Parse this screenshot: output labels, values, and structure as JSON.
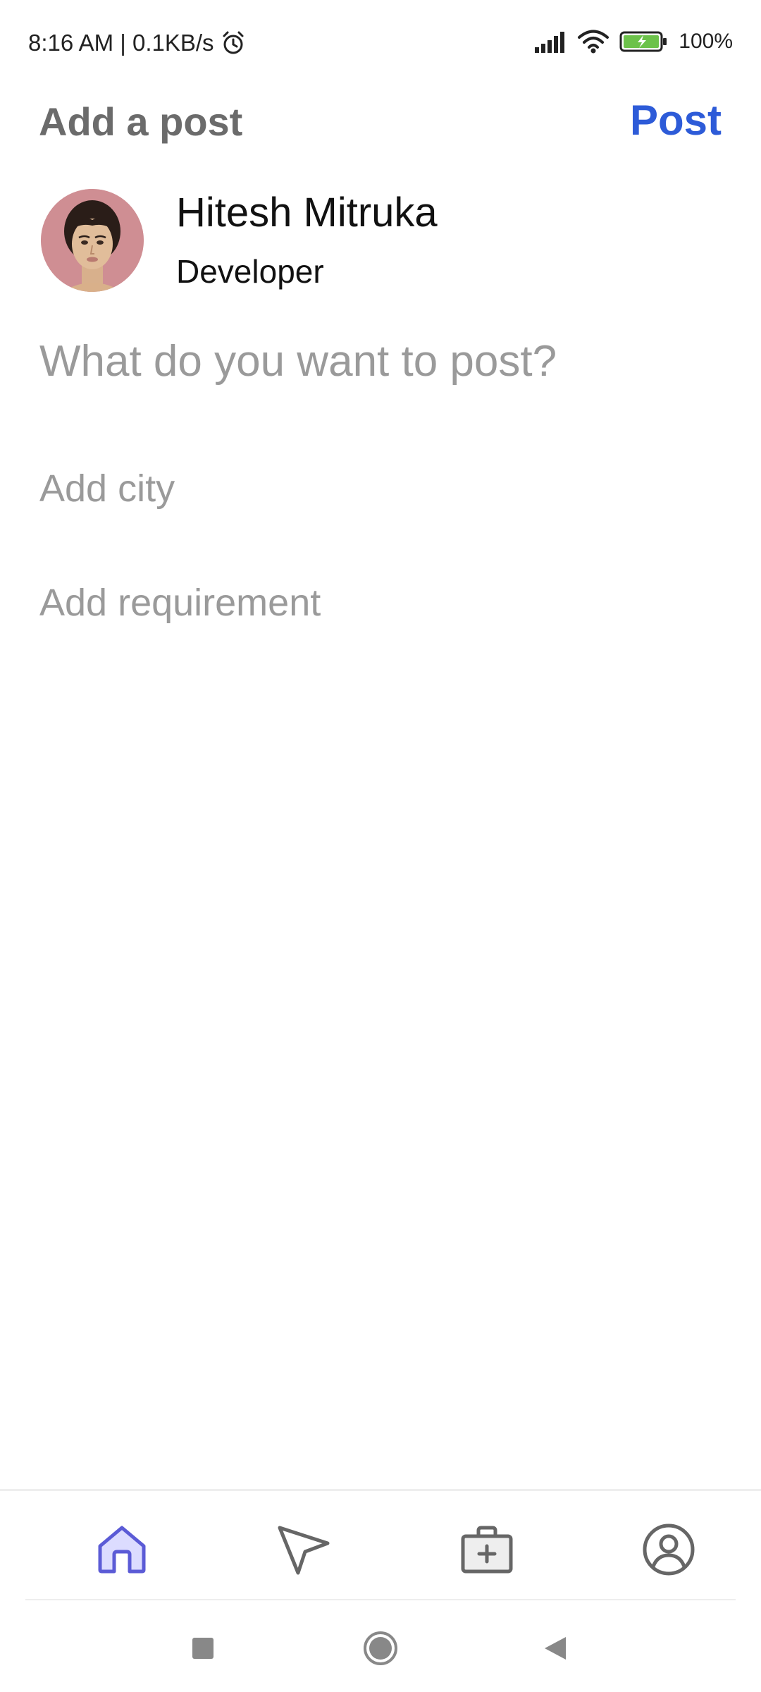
{
  "status_bar": {
    "time_speed": "8:16 AM | 0.1KB/s",
    "battery": "100%"
  },
  "header": {
    "title": "Add a post",
    "post_label": "Post"
  },
  "user": {
    "name": "Hitesh Mitruka",
    "role": "Developer"
  },
  "fields": {
    "post_placeholder": "What do you want to post?",
    "city_placeholder": "Add city",
    "requirement_placeholder": "Add requirement"
  },
  "bottom_nav": {
    "items": [
      {
        "icon": "home-icon",
        "active": true
      },
      {
        "icon": "send-icon",
        "active": false
      },
      {
        "icon": "briefcase-icon",
        "active": false
      },
      {
        "icon": "profile-icon",
        "active": false
      }
    ],
    "active_color": "#5b5bd6",
    "inactive_color": "#666666"
  },
  "colors": {
    "accent": "#2d5bd8",
    "title": "#6b6b6b",
    "placeholder": "#9a9a9a"
  }
}
